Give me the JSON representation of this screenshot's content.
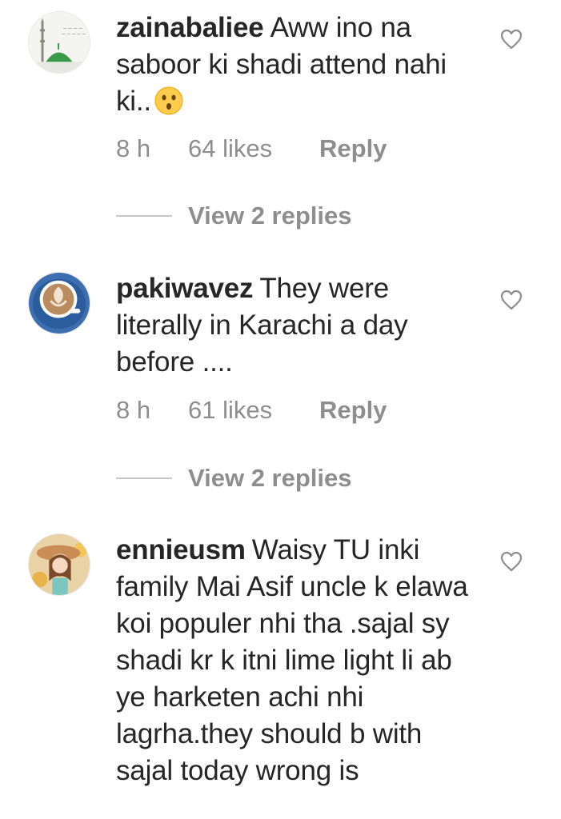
{
  "comments": [
    {
      "username": "zainabaliee",
      "text": "Aww ino na saboor ki shadi attend nahi ki..",
      "emoji": "hushed-face",
      "time": "8 h",
      "likes": "64 likes",
      "reply_label": "Reply",
      "view_replies": "View 2 replies"
    },
    {
      "username": "pakiwavez",
      "text": "They were literally in Karachi a day before ....",
      "time": "8 h",
      "likes": "61 likes",
      "reply_label": "Reply",
      "view_replies": "View 2 replies"
    },
    {
      "username": "ennieusm",
      "text": "Waisy TU inki family Mai Asif uncle k elawa koi populer nhi tha .sajal sy shadi kr k itni lime light li ab ye harketen achi nhi lagrha.they should b with sajal today wrong is"
    }
  ],
  "colors": {
    "text": "#262626",
    "secondary": "#8e8e8e",
    "divider": "#c7c7c7"
  }
}
